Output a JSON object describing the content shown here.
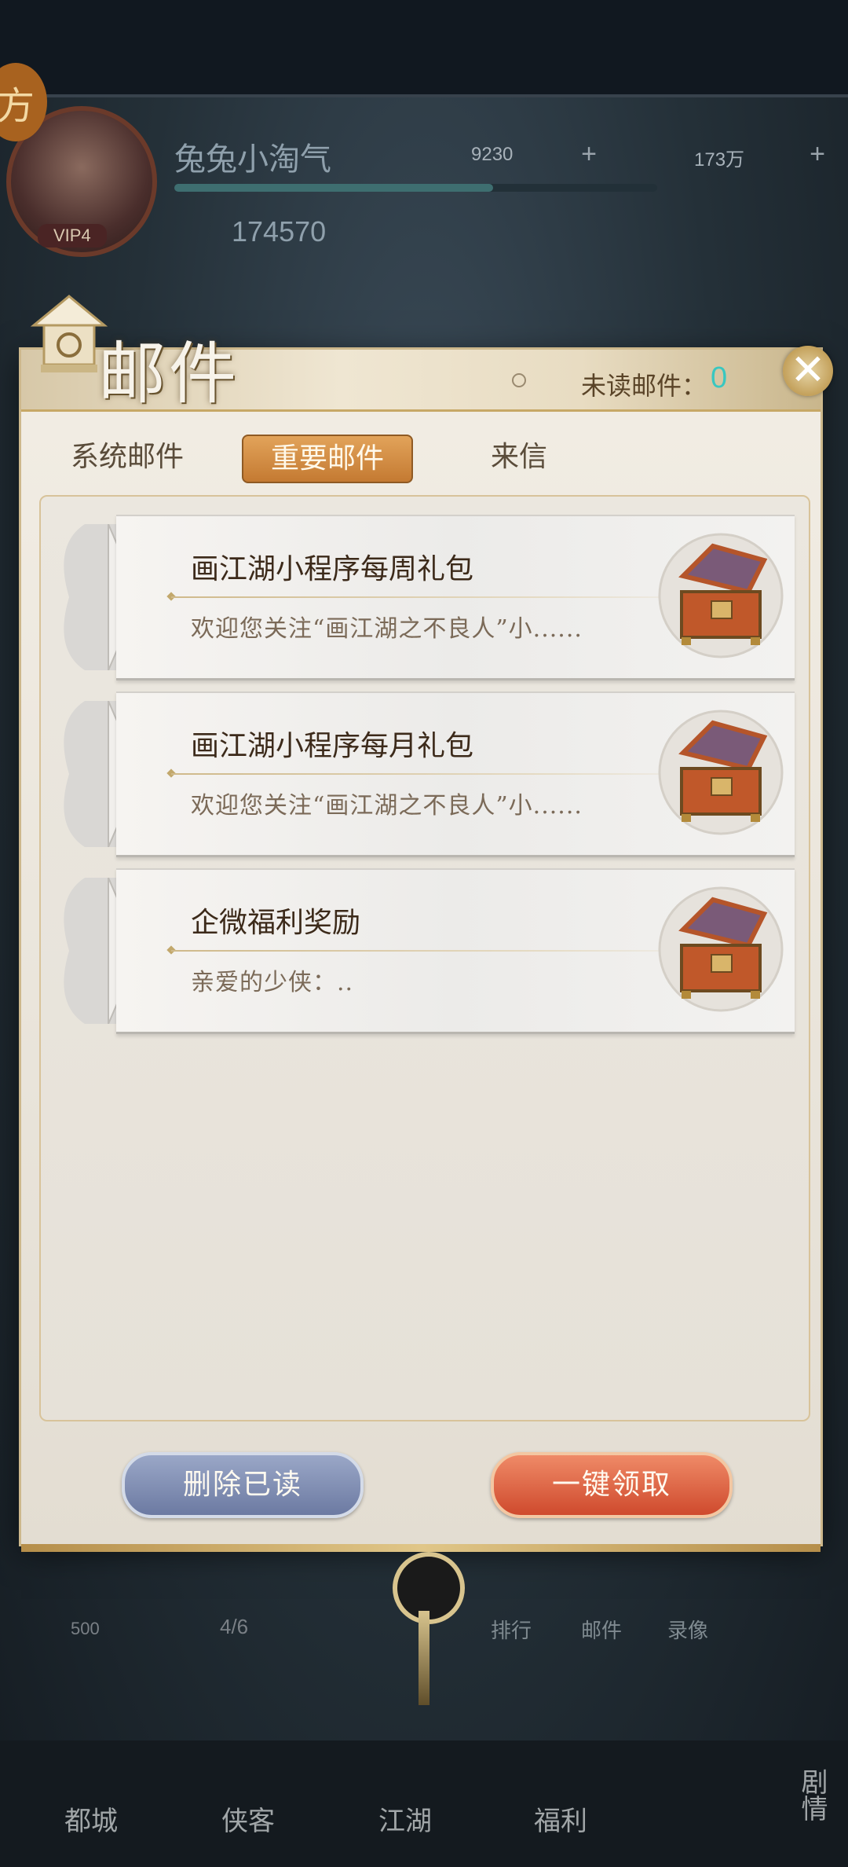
{
  "background": {
    "corner_badge": "方",
    "player_name": "兔兔小淘气",
    "vip": "VIP4",
    "currency_1": "9230",
    "currency_2": "173万",
    "power": "174570",
    "exp_progress": 0.66,
    "task": {
      "count": "500",
      "progress": "4/6"
    },
    "bottom_nav": [
      "都城",
      "侠客",
      "江湖",
      "福利",
      "剧情"
    ],
    "side_labels": [
      "排行",
      "邮件",
      "录像"
    ]
  },
  "dialog": {
    "title": "邮件",
    "unread_label": "未读邮件：",
    "unread_count": "0",
    "tabs": [
      {
        "label": "系统邮件",
        "selected": false
      },
      {
        "label": "重要邮件",
        "selected": true
      },
      {
        "label": "来信",
        "selected": false
      }
    ],
    "mails": [
      {
        "title": "画江湖小程序每周礼包",
        "preview": "欢迎您关注“画江湖之不良人”小......",
        "icon": "treasure-chest-icon"
      },
      {
        "title": "画江湖小程序每月礼包",
        "preview": "欢迎您关注“画江湖之不良人”小......",
        "icon": "treasure-chest-icon"
      },
      {
        "title": "企微福利奖励",
        "preview": "亲爱的少侠：..",
        "icon": "treasure-chest-icon"
      }
    ],
    "buttons": {
      "delete_read": "删除已读",
      "claim_all": "一键领取"
    }
  },
  "colors": {
    "accent_tab": "#c47a32",
    "unread_count": "#39c7c0",
    "delete_button": "#6c7aa2",
    "claim_button": "#cf4a2d"
  }
}
